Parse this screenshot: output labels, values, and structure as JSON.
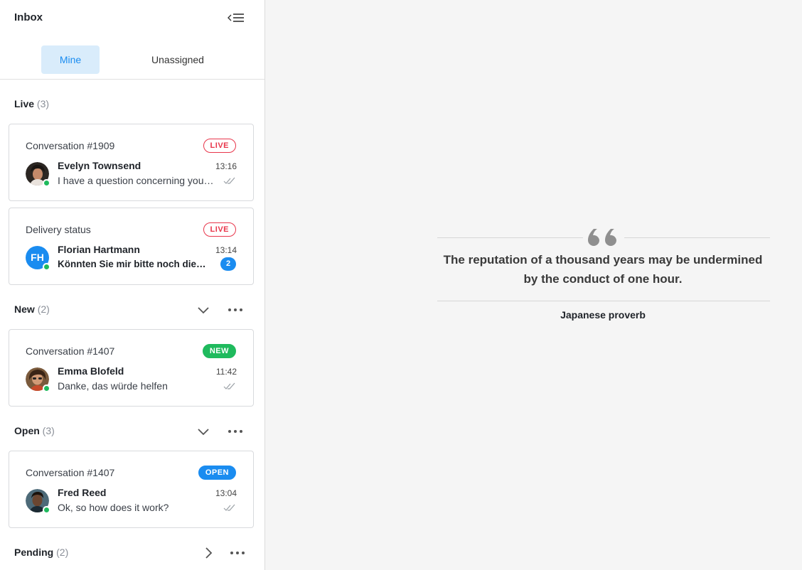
{
  "header": {
    "title": "Inbox"
  },
  "tabs": [
    {
      "label": "Mine",
      "active": true
    },
    {
      "label": "Unassigned",
      "active": false
    }
  ],
  "sections": {
    "live": {
      "label": "Live",
      "count": "(3)"
    },
    "new": {
      "label": "New",
      "count": "(2)"
    },
    "open": {
      "label": "Open",
      "count": "(3)"
    },
    "pending": {
      "label": "Pending",
      "count": "(2)"
    }
  },
  "conversations": [
    {
      "subject": "Conversation #1909",
      "badge": "LIVE",
      "name": "Evelyn Townsend",
      "time": "13:16",
      "preview": "I have a question concerning your product",
      "status": "read"
    },
    {
      "subject": "Delivery status",
      "badge": "LIVE",
      "name": "Florian Hartmann",
      "initials": "FH",
      "time": "13:14",
      "preview": "Könnten Sie mir bitte noch die Sendungsnummer",
      "unread": "2"
    },
    {
      "subject": "Conversation #1407",
      "badge": "NEW",
      "name": "Emma Blofeld",
      "time": "11:42",
      "preview": "Danke, das würde helfen",
      "status": "read"
    },
    {
      "subject": "Conversation #1407",
      "badge": "OPEN",
      "name": "Fred Reed",
      "time": "13:04",
      "preview": "Ok, so how does it work?",
      "status": "read"
    }
  ],
  "quote": {
    "text": "The reputation of a thousand years may be undermined by the conduct of one hour.",
    "author": "Japanese proverb"
  },
  "colors": {
    "accent": "#1a8cf0",
    "live": "#e8364b",
    "new": "#1fba5d",
    "online": "#1fba5d"
  },
  "icons": {
    "collapse": "collapse-sidebar-icon",
    "chevron_down": "chevron-down-icon",
    "chevron_right": "chevron-right-icon",
    "more": "more-horizontal-icon",
    "read": "double-check-icon",
    "quote": "quote-icon"
  }
}
